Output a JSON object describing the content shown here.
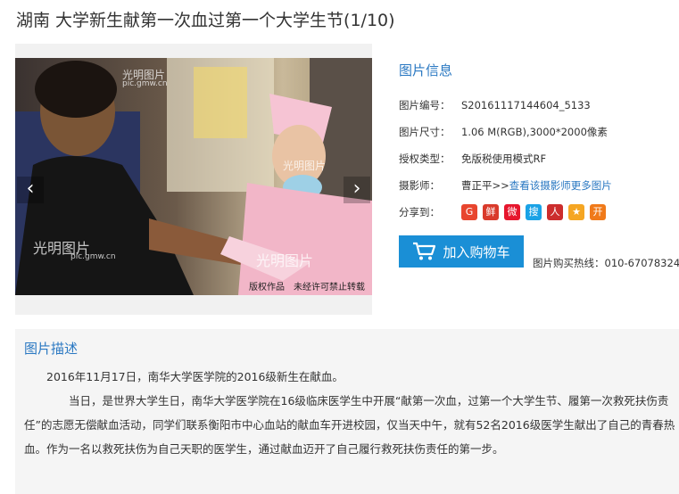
{
  "page": {
    "title": "湖南 大学新生献第一次血过第一个大学生节(1/10)"
  },
  "photo": {
    "alt_watermark": "光明图片",
    "watermark_url": "pic.gmw.cn",
    "copyright": "版权作品　未经许可禁止转载",
    "prev_glyph": "‹",
    "next_glyph": "›"
  },
  "info": {
    "title": "图片信息",
    "rows": [
      {
        "label": "图片编号：",
        "value": "S20161117144604_5133"
      },
      {
        "label": "图片尺寸：",
        "value": "1.06 M(RGB),3000*2000像素"
      },
      {
        "label": "授权类型：",
        "value": "免版税使用模式RF"
      },
      {
        "label": "摄影师：",
        "value": "曹正平",
        "sep": " >>",
        "link": "查看该摄影师更多图片"
      },
      {
        "label": "分享到："
      }
    ],
    "share": [
      {
        "name": "google-share-icon",
        "glyph": "G",
        "color": "#e8452e"
      },
      {
        "name": "xianguo-share-icon",
        "glyph": "鲜",
        "color": "#d93a2b"
      },
      {
        "name": "weibo-share-icon",
        "glyph": "微",
        "color": "#e6162d"
      },
      {
        "name": "sohu-share-icon",
        "glyph": "搜",
        "color": "#1aa2e6"
      },
      {
        "name": "renren-share-icon",
        "glyph": "人",
        "color": "#cc2d2d"
      },
      {
        "name": "qzone-share-icon",
        "glyph": "★",
        "color": "#f5a623"
      },
      {
        "name": "kaixin-share-icon",
        "glyph": "开",
        "color": "#f07a1a"
      }
    ]
  },
  "cart": {
    "label": "加入购物车"
  },
  "hotline": "图片购买热线：010-67078324",
  "description": {
    "title": "图片描述",
    "paragraph1": "2016年11月17日，南华大学医学院的2016级新生在献血。",
    "paragraph2": "当日，是世界大学生日，南华大学医学院在16级临床医学生中开展“献第一次血，过第一个大学生节、履第一次救死扶伤责任”的志愿无偿献血活动，同学们联系衡阳市中心血站的献血车开进校园，仅当天中午，就有52名2016级医学生献出了自己的青春热血。作为一名以救死扶伤为自己天职的医学生，通过献血迈开了自己履行救死扶伤责任的第一步。"
  }
}
